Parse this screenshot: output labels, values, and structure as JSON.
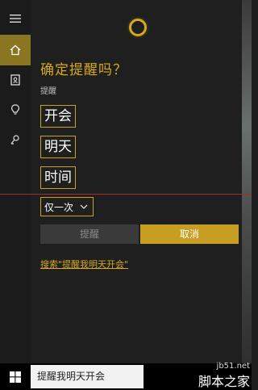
{
  "nav": {
    "items": [
      {
        "icon": "hamburger-icon"
      },
      {
        "icon": "home-icon",
        "active": true
      },
      {
        "icon": "notebook-icon"
      },
      {
        "icon": "lightbulb-icon"
      },
      {
        "icon": "feedback-icon"
      }
    ]
  },
  "reminder": {
    "question": "确定提醒吗？",
    "section_label": "提醒",
    "fields": [
      "开会",
      "明天",
      "时间"
    ],
    "repeat": "仅一次",
    "remind_button": "提醒",
    "cancel_button": "取消",
    "search_link": "搜索\"提醒我明天开会\""
  },
  "taskbar": {
    "search_value": "提醒我明天开会"
  },
  "watermark": {
    "url": "jb51.net",
    "brand": "脚本之家"
  },
  "colors": {
    "accent": "#d6a91d",
    "active_nav": "#8a7520",
    "disabled_button": "#3a3a3a"
  }
}
